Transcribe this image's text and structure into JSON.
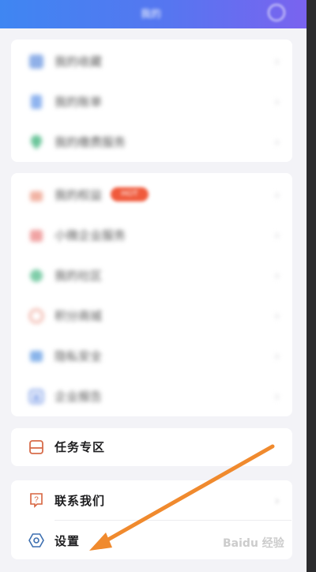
{
  "header": {
    "title": "我的",
    "settings_icon": "gear-icon"
  },
  "card1": {
    "items": [
      {
        "label": "我的收藏",
        "icon": "star-icon",
        "color": "#8fb0e8"
      },
      {
        "label": "我的账单",
        "icon": "document-icon",
        "color": "#8fb4ef"
      },
      {
        "label": "我的缴费服务",
        "icon": "location-icon",
        "color": "#6bc59a"
      }
    ]
  },
  "card2": {
    "items": [
      {
        "label": "我的权益",
        "icon": "gift-icon",
        "color": "#f1b3a3",
        "badge": "HOT"
      },
      {
        "label": "小微企业服务",
        "icon": "briefcase-icon",
        "color": "#f0a3a3"
      },
      {
        "label": "我的社区",
        "icon": "people-icon",
        "color": "#7fcda9"
      },
      {
        "label": "积分商城",
        "icon": "medal-icon",
        "color": "#f0b2a6"
      },
      {
        "label": "隐私安全",
        "icon": "shield-icon",
        "color": "#89b4ea"
      },
      {
        "label": "企业报告",
        "icon": "building-icon",
        "color": "#7f9fe8"
      }
    ]
  },
  "card3": {
    "items": [
      {
        "label": "任务专区",
        "icon": "task-icon",
        "color": "#d76c4a"
      }
    ]
  },
  "card4": {
    "items": [
      {
        "label": "联系我们",
        "icon": "question-icon",
        "color": "#d7643f"
      },
      {
        "label": "设置",
        "icon": "settings-icon",
        "color": "#3d6fb0"
      }
    ]
  },
  "annotation": {
    "type": "arrow",
    "color": "#f08a2e",
    "target": "设置"
  },
  "watermark": "Baidu 经验"
}
